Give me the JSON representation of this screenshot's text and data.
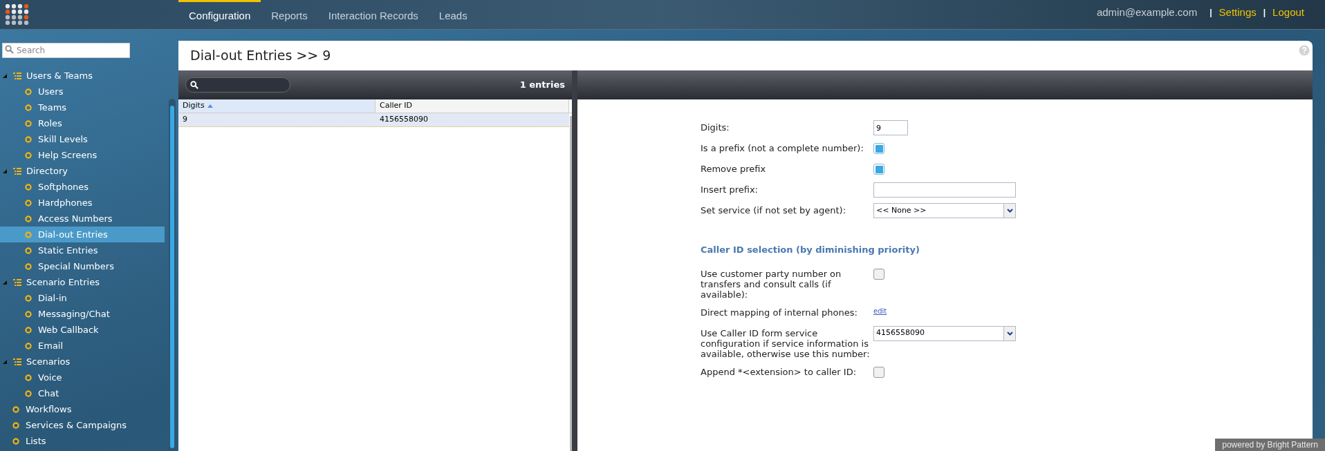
{
  "top_nav": {
    "tabs": [
      {
        "label": "Configuration",
        "selected": true
      },
      {
        "label": "Reports",
        "selected": false
      },
      {
        "label": "Interaction Records",
        "selected": false
      },
      {
        "label": "Leads",
        "selected": false
      }
    ],
    "user": "admin@example.com",
    "separator": "|",
    "links": [
      "Settings",
      "Logout"
    ]
  },
  "sidebar": {
    "search": {
      "placeholder": "Search"
    },
    "items": [
      {
        "label": "Users & Teams",
        "expanded": true,
        "children": [
          {
            "label": "Users",
            "selected": false
          },
          {
            "label": "Teams",
            "selected": false
          },
          {
            "label": "Roles",
            "selected": false
          },
          {
            "label": "Skill Levels",
            "selected": false
          },
          {
            "label": "Help Screens",
            "selected": false
          }
        ]
      },
      {
        "label": "Directory",
        "expanded": true,
        "children": [
          {
            "label": "Softphones",
            "selected": false
          },
          {
            "label": "Hardphones",
            "selected": false
          },
          {
            "label": "Access Numbers",
            "selected": false
          },
          {
            "label": "Dial-out Entries",
            "selected": true
          },
          {
            "label": "Static Entries",
            "selected": false
          },
          {
            "label": "Special Numbers",
            "selected": false
          }
        ]
      },
      {
        "label": "Scenario Entries",
        "expanded": true,
        "children": [
          {
            "label": "Dial-in",
            "selected": false
          },
          {
            "label": "Messaging/Chat",
            "selected": false
          },
          {
            "label": "Web Callback",
            "selected": false
          },
          {
            "label": "Email",
            "selected": false
          }
        ]
      },
      {
        "label": "Scenarios",
        "expanded": true,
        "children": [
          {
            "label": "Voice",
            "selected": false
          },
          {
            "label": "Chat",
            "selected": false
          }
        ]
      },
      {
        "label": "Workflows",
        "selected": false
      },
      {
        "label": "Services & Campaigns",
        "selected": false
      },
      {
        "label": "Lists",
        "selected": false
      }
    ]
  },
  "page": {
    "title": "Dial-out Entries >> 9",
    "list": {
      "count": "1 entries",
      "columns": [
        {
          "label": "Digits",
          "sorted": true
        },
        {
          "label": "Caller ID",
          "sorted": false
        }
      ],
      "rows": [
        {
          "cells": [
            "9",
            "4156558090"
          ],
          "selected": true
        }
      ]
    },
    "form": {
      "rows": [
        {
          "kind": "narrow",
          "label": "Digits:",
          "value": "9"
        },
        {
          "kind": "checkbox",
          "label": "Is a prefix (not a complete number):",
          "checked": true
        },
        {
          "kind": "checkbox",
          "label": "Remove prefix",
          "checked": true
        },
        {
          "kind": "text",
          "label": "Insert prefix:",
          "value": ""
        },
        {
          "kind": "select",
          "label": "Set service (if not set by agent):",
          "value": "<< None >>"
        },
        {
          "kind": "heading",
          "label": "Caller ID selection (by diminishing priority)"
        },
        {
          "kind": "checkbox",
          "label": "Use customer party number on transfers and consult calls (if available):",
          "checked": false
        },
        {
          "kind": "link",
          "label": "Direct mapping of internal phones:",
          "value": "edit"
        },
        {
          "kind": "select",
          "label": "Use Caller ID form service configuration if service information is available, otherwise use this number:",
          "value": "4156558090"
        },
        {
          "kind": "checkbox",
          "label": "Append *<extension> to caller ID:",
          "checked": false
        }
      ]
    }
  },
  "footer": "powered by Bright Pattern"
}
